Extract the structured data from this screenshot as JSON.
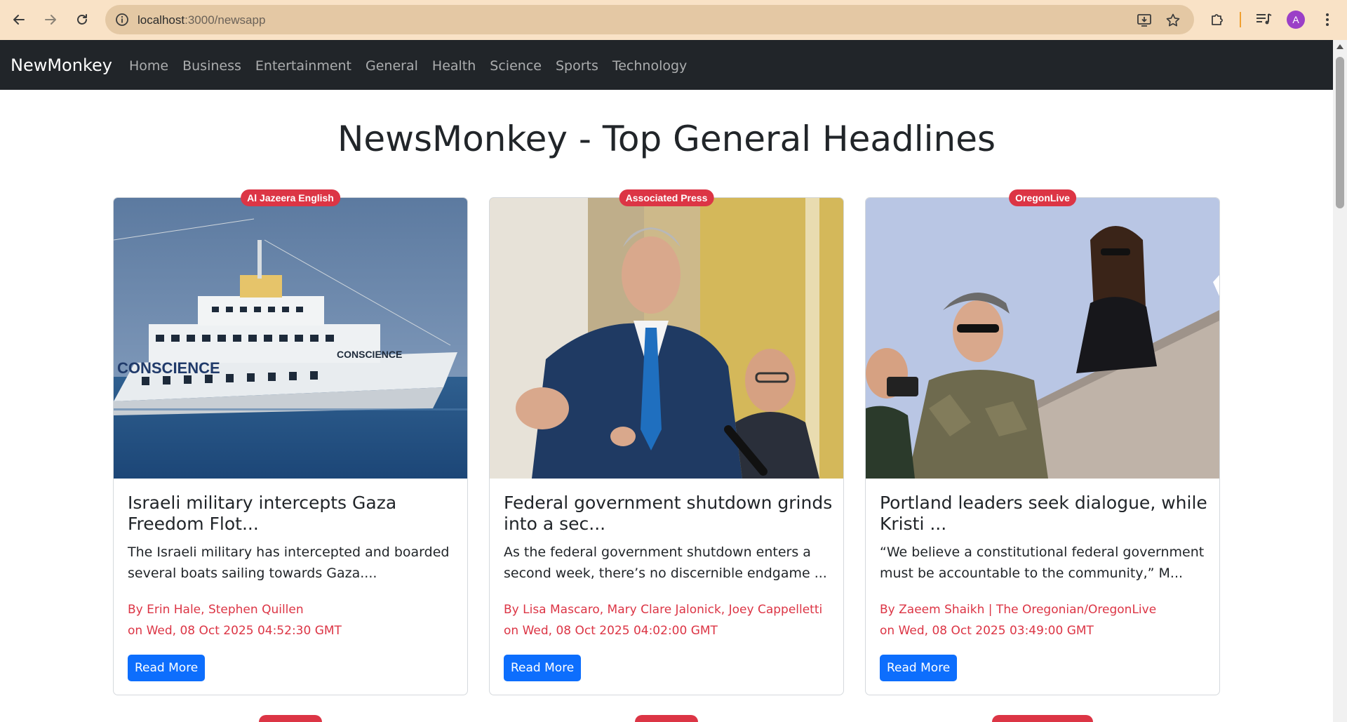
{
  "browser": {
    "url_host": "localhost",
    "url_path": ":3000/newsapp",
    "avatar_letter": "A"
  },
  "navbar": {
    "brand": "NewMonkey",
    "links": [
      "Home",
      "Business",
      "Entertainment",
      "General",
      "Health",
      "Science",
      "Sports",
      "Technology"
    ]
  },
  "page": {
    "title": "NewsMonkey - Top General Headlines"
  },
  "cards": [
    {
      "source": "Al Jazeera English",
      "title": "Israeli military intercepts Gaza Freedom Flot...",
      "description": "The Israeli military has intercepted and boarded several boats sailing towards Gaza....",
      "author": "By Erin Hale, Stephen Quillen",
      "date": "on Wed, 08 Oct 2025 04:52:30 GMT",
      "button": "Read More"
    },
    {
      "source": "Associated Press",
      "title": "Federal government shutdown grinds into a sec...",
      "description": "As the federal government shutdown enters a second week, there’s no discernible endgame ...",
      "author": "By Lisa Mascaro, Mary Clare Jalonick, Joey Cappelletti",
      "date": "on Wed, 08 Oct 2025 04:02:00 GMT",
      "button": "Read More"
    },
    {
      "source": "OregonLive",
      "title": "Portland leaders seek dialogue, while Kristi ...",
      "description": "“We believe a constitutional federal government must be accountable to the community,” M...",
      "author": "By Zaeem Shaikh | The Oregonian/OregonLive",
      "date": "on Wed, 08 Oct 2025 03:49:00 GMT",
      "button": "Read More"
    }
  ],
  "image_labels": {
    "ship_name": "CONSCIENCE"
  },
  "colors": {
    "browser_chrome": "#f9e2c6",
    "navbar": "#212529",
    "badge": "#dc3545",
    "button": "#0d6efd"
  }
}
